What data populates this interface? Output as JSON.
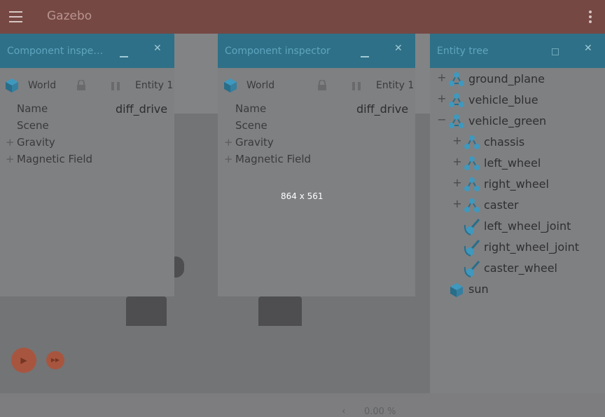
{
  "app": {
    "title": "Gazebo"
  },
  "inspector_left": {
    "title": "Component inspe…",
    "world_label": "World",
    "entity_label": "Entity 1",
    "name_label": "Name",
    "name_value": "diff_drive",
    "scene_label": "Scene",
    "gravity_label": "Gravity",
    "magnetic_label": "Magnetic Field",
    "minimize": "–",
    "close": "✕"
  },
  "inspector_right": {
    "title": "Component inspector",
    "world_label": "World",
    "entity_label": "Entity 1",
    "name_label": "Name",
    "name_value": "diff_drive",
    "scene_label": "Scene",
    "gravity_label": "Gravity",
    "magnetic_label": "Magnetic Field",
    "minimize": "–",
    "close": "✕"
  },
  "entity_tree": {
    "title": "Entity tree",
    "close": "✕",
    "items": [
      {
        "label": "ground_plane",
        "toggle": "+",
        "icon": "model-icon"
      },
      {
        "label": "vehicle_blue",
        "toggle": "+",
        "icon": "model-icon"
      },
      {
        "label": "vehicle_green",
        "toggle": "−",
        "icon": "model-icon"
      },
      {
        "label": "chassis",
        "toggle": "+",
        "icon": "link-icon"
      },
      {
        "label": "left_wheel",
        "toggle": "+",
        "icon": "link-icon"
      },
      {
        "label": "right_wheel",
        "toggle": "+",
        "icon": "link-icon"
      },
      {
        "label": "caster",
        "toggle": "+",
        "icon": "link-icon"
      },
      {
        "label": "left_wheel_joint",
        "toggle": "",
        "icon": "joint-icon"
      },
      {
        "label": "right_wheel_joint",
        "toggle": "",
        "icon": "joint-icon"
      },
      {
        "label": "caster_wheel",
        "toggle": "",
        "icon": "joint-icon"
      },
      {
        "label": "sun",
        "toggle": "",
        "icon": "light-icon"
      }
    ]
  },
  "playback": {
    "progress": "0.00 %",
    "play": "▶",
    "step": "▶▶",
    "back": "‹"
  },
  "dimension_label": "864 x 561",
  "colors": {
    "appbar": "#764844",
    "panel_header": "#2e7087",
    "accent": "#a8553f"
  }
}
